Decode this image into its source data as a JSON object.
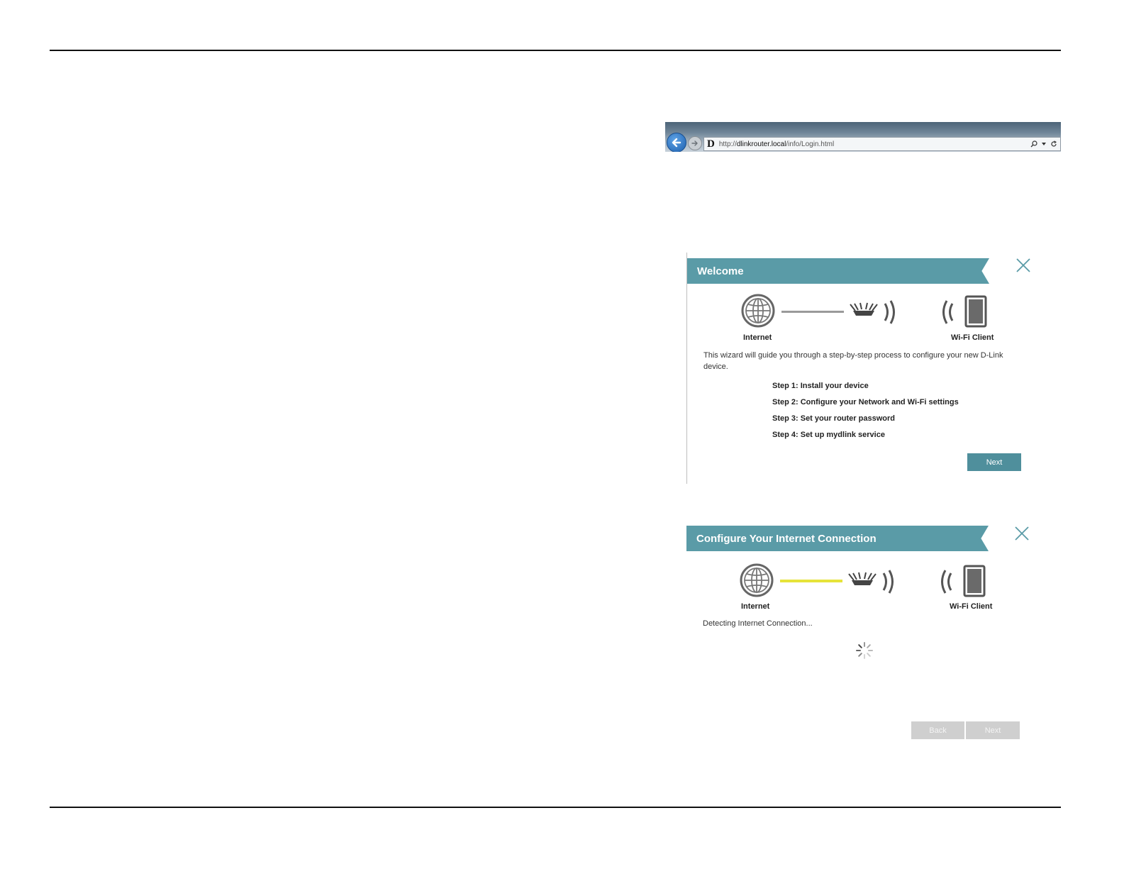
{
  "browser": {
    "url_prefix": "http://",
    "url_host": "dlinkrouter.local",
    "url_path": "/info/Login.html",
    "logo": "D"
  },
  "welcome": {
    "title": "Welcome",
    "internet_label": "Internet",
    "client_label": "Wi-Fi Client",
    "description": "This wizard will guide you through a step-by-step process to configure your new D-Link device.",
    "steps": [
      "Step 1: Install your device",
      "Step 2: Configure your Network and Wi-Fi settings",
      "Step 3: Set your router password",
      "Step 4: Set up mydlink service"
    ],
    "next_label": "Next"
  },
  "configure": {
    "title": "Configure Your Internet Connection",
    "internet_label": "Internet",
    "client_label": "Wi-Fi Client",
    "status": "Detecting Internet Connection...",
    "back_label": "Back",
    "next_label": "Next"
  },
  "colors": {
    "banner": "#5a9ba7",
    "button": "#4f8f9c",
    "link_idle": "#9a9a9a",
    "link_detecting": "#e6e33a",
    "button_disabled": "#cfcfcf"
  }
}
